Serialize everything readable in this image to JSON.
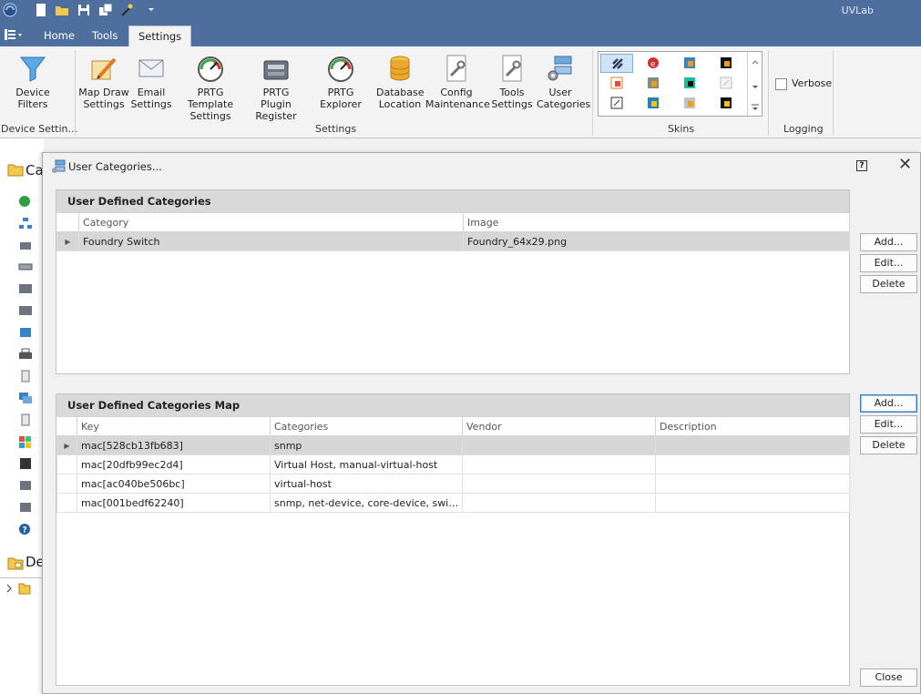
{
  "app": {
    "title": "UVLab"
  },
  "tabs": [
    {
      "label": "Home",
      "active": false
    },
    {
      "label": "Tools",
      "active": false
    },
    {
      "label": "Settings",
      "active": true
    }
  ],
  "ribbon": {
    "groups": {
      "device_settings": "Device Settin...",
      "settings": "Settings",
      "skins": "Skins",
      "logging": "Logging"
    },
    "buttons": {
      "device_filters": "Device\nFilters",
      "map_draw": "Map Draw\nSettings",
      "email": "Email\nSettings",
      "prtg_template": "PRTG Template\nSettings",
      "prtg_plugin": "PRTG Plugin\nRegister",
      "prtg_explorer": "PRTG Explorer",
      "database": "Database\nLocation",
      "config": "Config\nMaintenance",
      "tools": "Tools\nSettings",
      "user_categories": "User\nCategories"
    },
    "verbose": {
      "label": "Verbose",
      "checked": false
    }
  },
  "left_panel": {
    "header1": "Ca",
    "header2": "De"
  },
  "dialog": {
    "title": "User Categories...",
    "categories": {
      "header": "User Defined Categories",
      "columns": [
        "Category",
        "Image"
      ],
      "rows": [
        {
          "category": "Foundry Switch",
          "image": "Foundry_64x29.png",
          "selected": true
        }
      ]
    },
    "map": {
      "header": "User Defined Categories Map",
      "columns": [
        "Key",
        "Categories",
        "Vendor",
        "Description"
      ],
      "rows": [
        {
          "key": "mac[528cb13fb683]",
          "categories": "snmp",
          "vendor": "",
          "description": "",
          "selected": true
        },
        {
          "key": "mac[20dfb99ec2d4]",
          "categories": "Virtual Host, manual-virtual-host",
          "vendor": "",
          "description": "",
          "selected": false
        },
        {
          "key": "mac[ac040be506bc]",
          "categories": "virtual-host",
          "vendor": "",
          "description": "",
          "selected": false
        },
        {
          "key": "mac[001bedf62240]",
          "categories": "snmp, net-device, core-device, switch, ...",
          "vendor": "",
          "description": "",
          "selected": false
        }
      ]
    },
    "buttons": {
      "add": "Add...",
      "edit": "Edit...",
      "delete": "Delete",
      "close": "Close"
    }
  },
  "colors": {
    "title_bar": "#4e6e9e",
    "ribbon_bg": "#f3f3f3",
    "selected_row": "#d6d6d6",
    "panel_header": "#d9d9d9"
  }
}
